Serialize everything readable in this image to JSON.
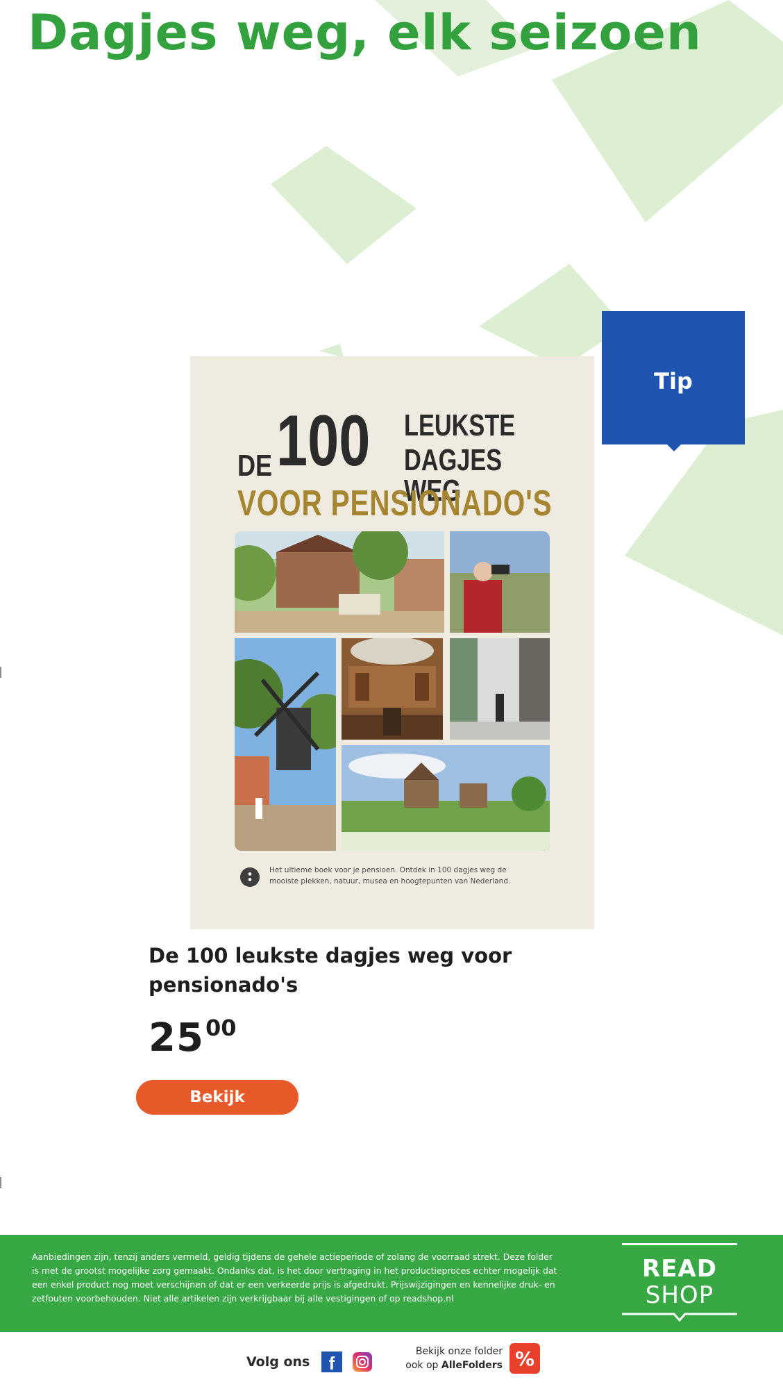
{
  "headline": "Dagjes weg, elk seizoen",
  "badge": {
    "label": "Tip"
  },
  "book_cover": {
    "de": "DE",
    "number": "100",
    "line1": "LEUKSTE",
    "line2": "DAGJES WEG",
    "subtitle": "VOOR PENSIONADO'S",
    "blurb_line1": "Het ultieme boek voor je pensioen. Ontdek in 100 dagjes weg de",
    "blurb_line2": "mooiste plekken, natuur, musea en hoogtepunten van Nederland."
  },
  "product": {
    "title_line1": "De 100 leukste dagjes weg voor",
    "title_line2": "pensionado's",
    "price_euros": "25",
    "price_cents": "00",
    "button_label": "Bekijk"
  },
  "footer": {
    "disclaimer_lines": [
      "Aanbiedingen zijn, tenzij anders vermeld, geldig tijdens de gehele actieperiode of zolang de voorraad strekt. Deze folder",
      "is met de grootst mogelijke zorg gemaakt. Ondanks dat, is het door vertraging in het productieproces echter mogelijk dat",
      "een enkel product nog moet verschijnen of dat er een verkeerde prijs is afgedrukt. Prijswijzigingen en kennelijke druk- en",
      "zetfouten voorbehouden. Niet alle artikelen zijn verkrijgbaar bij alle vestigingen of op readshop.nl"
    ],
    "logo_line1": "READ",
    "logo_line2": "SHOP",
    "follow_label": "Volg ons",
    "facebook_glyph": "f",
    "allefolders_line1": "Bekijk onze folder",
    "allefolders_prefix": "ook op ",
    "allefolders_brand": "AlleFolders",
    "percent_glyph": "%"
  },
  "colors": {
    "brand_green": "#33a13d",
    "footer_green": "#38a845",
    "tip_blue": "#1f55b0",
    "button_orange": "#e8592a",
    "cover_gold": "#a5852f",
    "cover_bg": "#efebe0",
    "leaf_green": "#dcefd2"
  },
  "icons": [
    "facebook-icon",
    "instagram-icon",
    "percent-icon",
    "book-logo-icon"
  ]
}
